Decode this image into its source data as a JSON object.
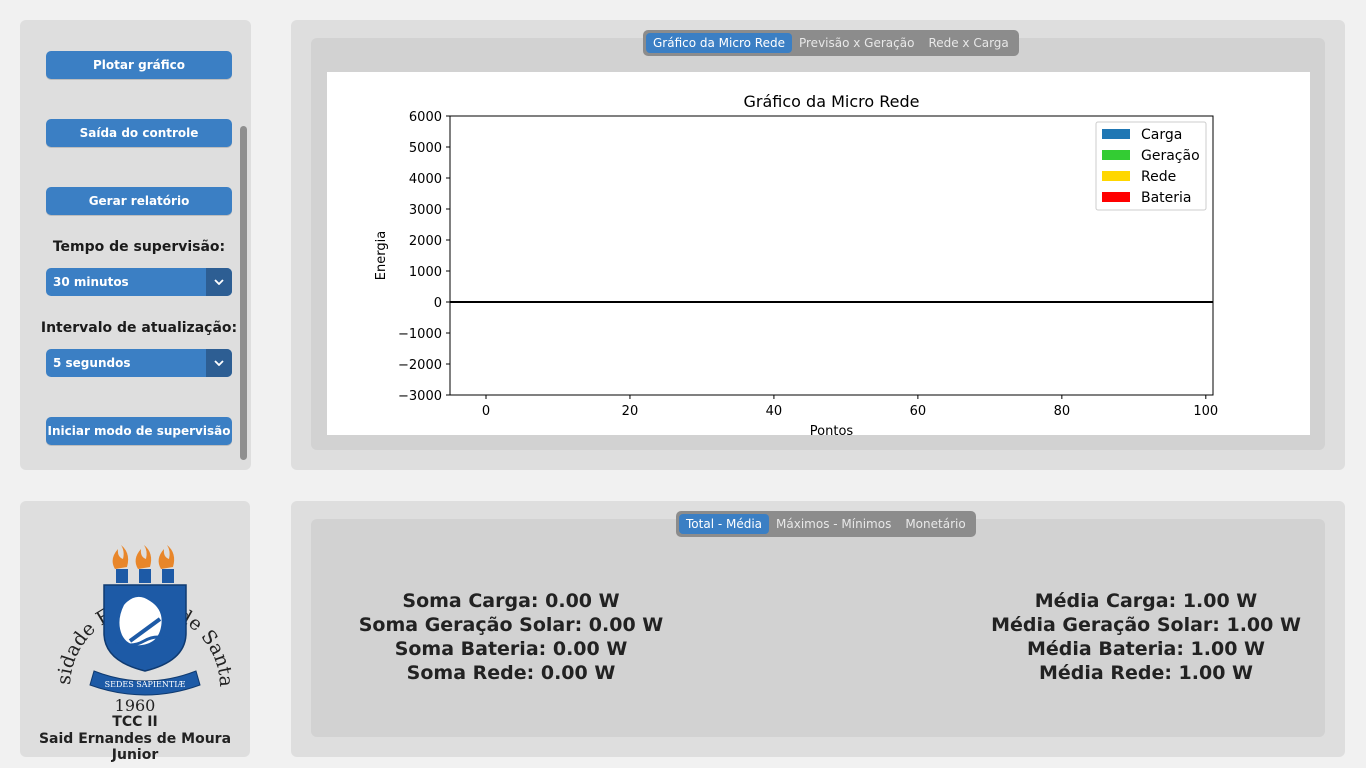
{
  "controls": {
    "plot_button": "Plotar gráfico",
    "output_button": "Saída do controle",
    "report_button": "Gerar relatório",
    "supervision_time_label": "Tempo de supervisão:",
    "supervision_time_value": "30 minutos",
    "update_interval_label": "Intervalo de atualização:",
    "update_interval_value": "5 segundos",
    "start_button": "Iniciar modo de supervisão"
  },
  "chart_tabs": [
    {
      "label": "Gráfico da Micro Rede",
      "active": true
    },
    {
      "label": "Previsão x Geração",
      "active": false
    },
    {
      "label": "Rede x Carga",
      "active": false
    }
  ],
  "chart_data": {
    "type": "bar",
    "title": "Gráfico da Micro Rede",
    "xlabel": "Pontos",
    "ylabel": "Energia",
    "xlim": [
      -5,
      101
    ],
    "ylim": [
      -3000,
      6000
    ],
    "xticks": [
      0,
      20,
      40,
      60,
      80,
      100
    ],
    "yticks": [
      6000,
      5000,
      4000,
      3000,
      2000,
      1000,
      0,
      -1000,
      -2000,
      -3000
    ],
    "ytick_labels": [
      "6000",
      "5000",
      "4000",
      "3000",
      "2000",
      "1000",
      "0",
      "−1000",
      "−2000",
      "−3000"
    ],
    "legend_position": "top-right",
    "grid": false,
    "series": [
      {
        "name": "Carga",
        "color": "#1f77b4",
        "values": []
      },
      {
        "name": "Geração",
        "color": "#33cc33",
        "values": []
      },
      {
        "name": "Rede",
        "color": "#ffd700",
        "values": []
      },
      {
        "name": "Bateria",
        "color": "#ff0000",
        "values": []
      }
    ],
    "baseline": 0
  },
  "logo": {
    "university": "Universidade Federal de Santa Maria",
    "motto": "SEDES SAPIENTIÆ",
    "year": "1960"
  },
  "credits": {
    "course": "TCC II",
    "author": "Said Ernandes de Moura Junior"
  },
  "stat_tabs": [
    {
      "label": "Total - Média",
      "active": true
    },
    {
      "label": "Máximos - Mínimos",
      "active": false
    },
    {
      "label": "Monetário",
      "active": false
    }
  ],
  "stats": {
    "soma_carga": "Soma Carga: 0.00 W",
    "soma_geracao": "Soma Geração Solar: 0.00 W",
    "soma_bateria": "Soma Bateria: 0.00 W",
    "soma_rede": "Soma Rede: 0.00 W",
    "media_carga": "Média Carga: 1.00 W",
    "media_geracao": "Média Geração Solar: 1.00 W",
    "media_bateria": "Média Bateria: 1.00 W",
    "media_rede": "Média Rede: 1.00 W"
  },
  "colors": {
    "accent": "#3b7fc4",
    "accent_dark": "#2d5e93",
    "logo_blue": "#1d5aa6",
    "logo_flame": "#e8862a"
  }
}
